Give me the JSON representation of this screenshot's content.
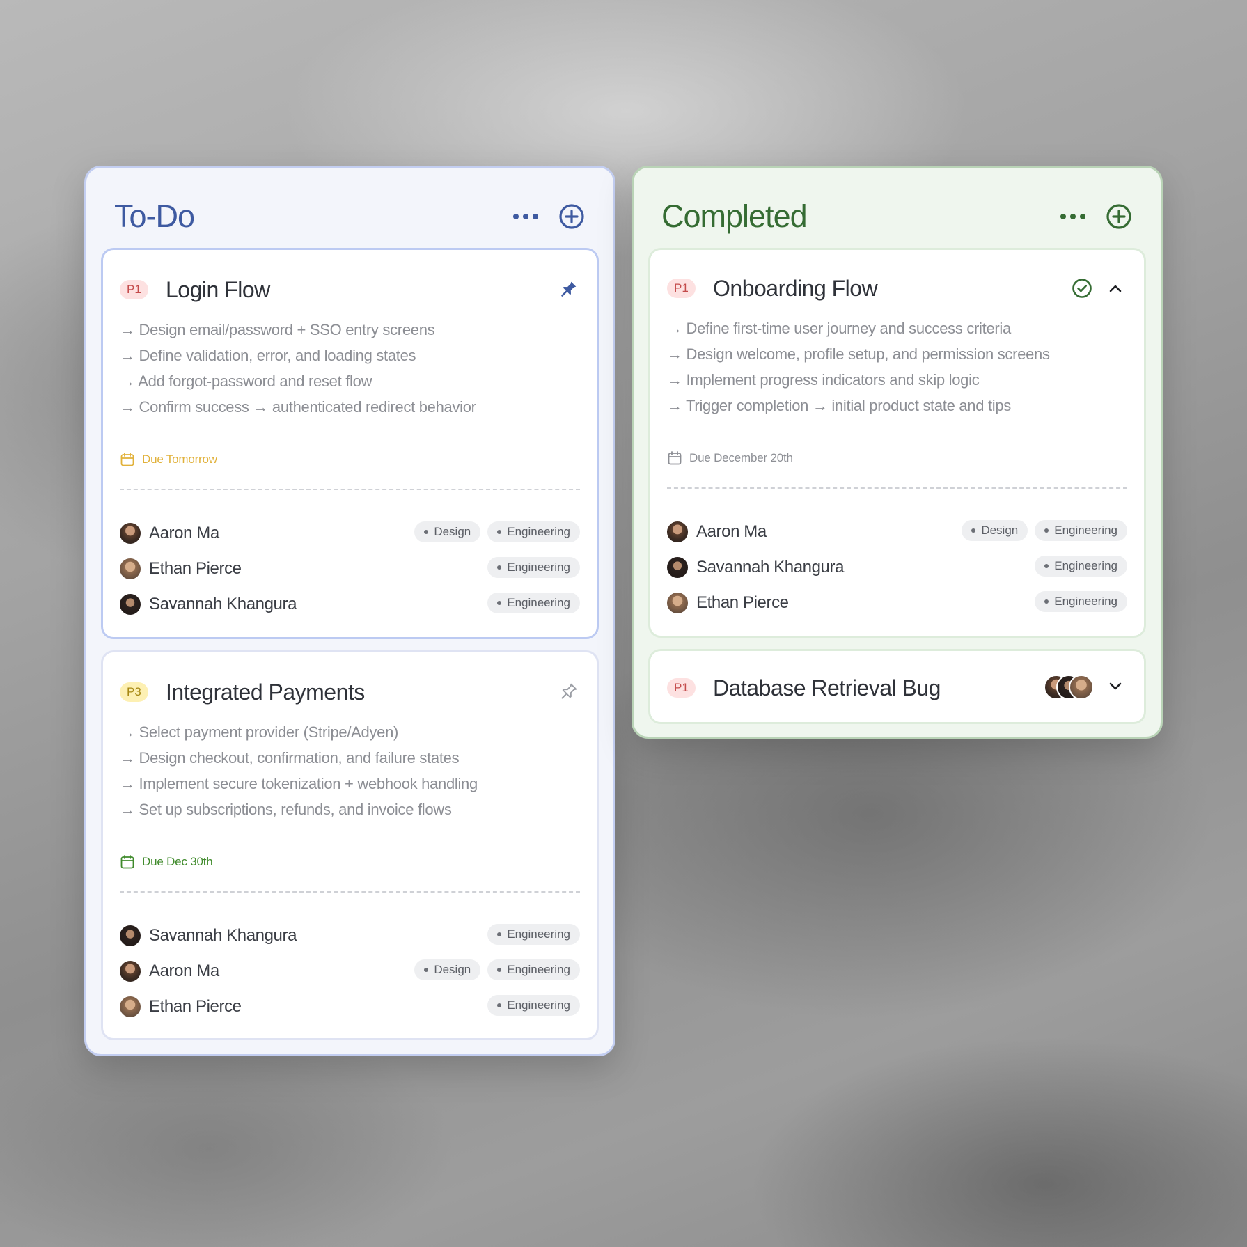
{
  "todo": {
    "title": "To-Do",
    "cards": [
      {
        "priority": "P1",
        "title": "Login Flow",
        "lines": [
          "→ Design email/password + SSO entry screens",
          "→ Define validation, error, and loading states",
          "→ Add forgot-password and reset flow",
          "→ Confirm success → authenticated redirect behavior"
        ],
        "due": "Due Tomorrow",
        "members": [
          {
            "name": "Aaron Ma",
            "tags": [
              "Design",
              "Engineering"
            ]
          },
          {
            "name": "Ethan Pierce",
            "tags": [
              "Engineering"
            ]
          },
          {
            "name": "Savannah Khangura",
            "tags": [
              "Engineering"
            ]
          }
        ]
      },
      {
        "priority": "P3",
        "title": "Integrated Payments",
        "lines": [
          "→ Select payment provider (Stripe/Adyen)",
          "→ Design checkout, confirmation, and failure states",
          "→ Implement secure tokenization + webhook handling",
          "→ Set up subscriptions, refunds, and invoice flows"
        ],
        "due": "Due Dec 30th",
        "members": [
          {
            "name": "Savannah Khangura",
            "tags": [
              "Engineering"
            ]
          },
          {
            "name": "Aaron Ma",
            "tags": [
              "Design",
              "Engineering"
            ]
          },
          {
            "name": "Ethan Pierce",
            "tags": [
              "Engineering"
            ]
          }
        ]
      }
    ]
  },
  "completed": {
    "title": "Completed",
    "cards": [
      {
        "priority": "P1",
        "title": "Onboarding Flow",
        "lines": [
          "→ Define first-time user journey and success criteria",
          "→ Design welcome, profile setup, and permission screens",
          "→ Implement progress indicators and skip logic",
          "→ Trigger completion → initial product state and tips"
        ],
        "due": "Due December 20th",
        "members": [
          {
            "name": "Aaron Ma",
            "tags": [
              "Design",
              "Engineering"
            ]
          },
          {
            "name": "Savannah Khangura",
            "tags": [
              "Engineering"
            ]
          },
          {
            "name": "Ethan Pierce",
            "tags": [
              "Engineering"
            ]
          }
        ]
      },
      {
        "priority": "P1",
        "title": "Database Retrieval Bug"
      }
    ]
  },
  "colors": {
    "todo_accent": "#3e5aa1",
    "completed_accent": "#356c33",
    "due_tomorrow": "#e1b13a",
    "due_green": "#3f8a2b",
    "p1_badge": "#fde1e1",
    "p3_badge": "#fdf0b3"
  },
  "icons": {
    "pinned": "pin-filled-icon",
    "unpinned": "pin-outline-icon",
    "more": "more-dots-icon",
    "add": "plus-circle-icon",
    "done": "check-circle-icon",
    "collapse": "chevron-up-icon",
    "expand": "chevron-down-icon",
    "due": "calendar-icon"
  }
}
